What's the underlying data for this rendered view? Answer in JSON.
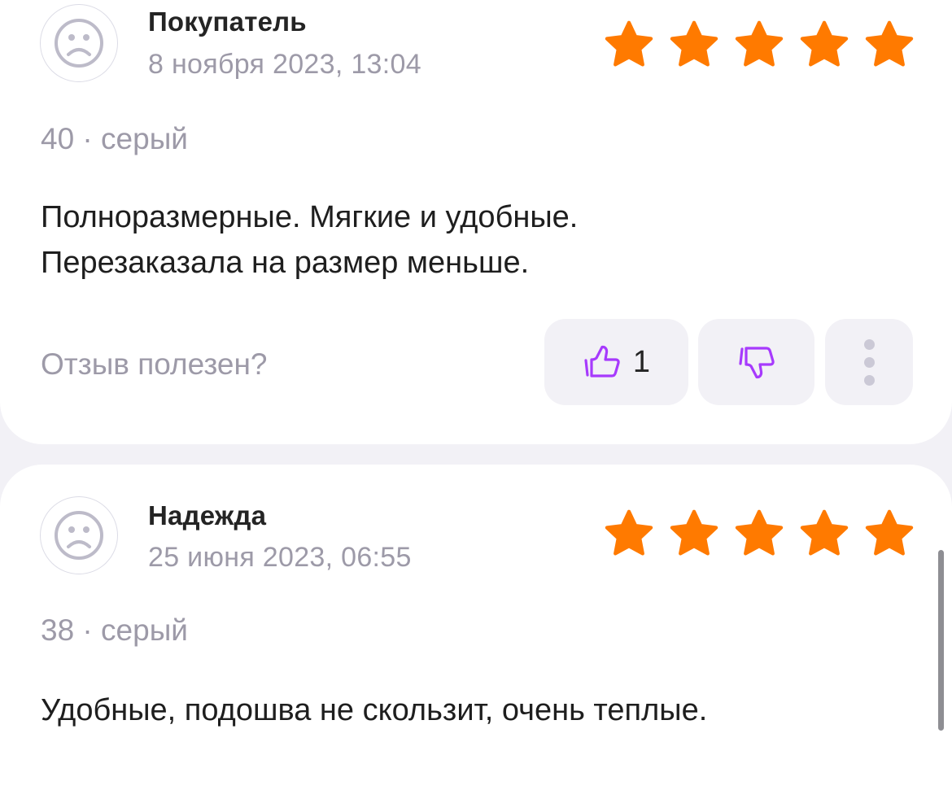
{
  "colors": {
    "star": "#ff7a00",
    "accent": "#a73afd",
    "muted": "#9d9aa8",
    "background": "#f2f1f6"
  },
  "reviews": [
    {
      "author": "Покупатель",
      "date": "8 ноября 2023, 13:04",
      "rating": 5,
      "meta": "40 · серый",
      "text_lines": [
        "Полноразмерные. Мягкие и удобные.",
        "Перезаказала на размер меньше."
      ],
      "helpful_question": "Отзыв полезен?",
      "likes": "1",
      "icons": {
        "avatar": "sad-face-icon",
        "like": "thumbs-up-icon",
        "dislike": "thumbs-down-icon",
        "more": "more-vertical-icon",
        "star": "star-icon"
      }
    },
    {
      "author": "Надежда",
      "date": "25 июня 2023, 06:55",
      "rating": 5,
      "meta": "38 · серый",
      "text_lines": [
        "Удобные, подошва не скользит, очень теплые."
      ],
      "icons": {
        "avatar": "sad-face-icon",
        "star": "star-icon"
      }
    }
  ]
}
